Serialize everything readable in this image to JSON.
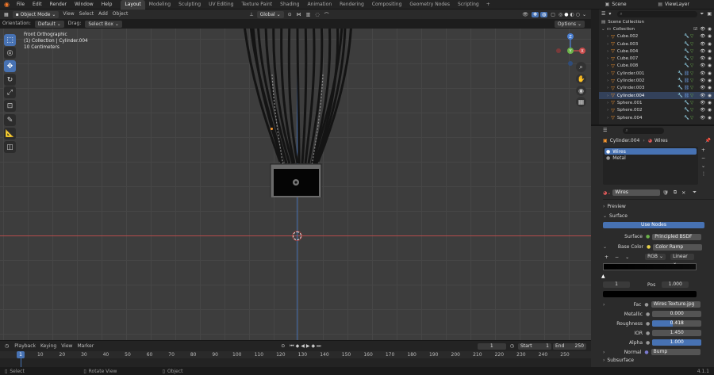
{
  "topbar": {
    "menus": [
      "File",
      "Edit",
      "Render",
      "Window",
      "Help"
    ],
    "workspaces": [
      "Layout",
      "Modeling",
      "Sculpting",
      "UV Editing",
      "Texture Paint",
      "Shading",
      "Animation",
      "Rendering",
      "Compositing",
      "Geometry Nodes",
      "Scripting"
    ],
    "active_workspace": "Layout",
    "scene": "Scene",
    "view_layer": "ViewLayer"
  },
  "viewport_header": {
    "mode": "Object Mode",
    "menus": [
      "View",
      "Select",
      "Add",
      "Object"
    ],
    "transform_orientation": "Global",
    "options_label": "Options"
  },
  "tool_header": {
    "orientation_label": "Orientation:",
    "orientation_value": "Default",
    "drag_label": "Drag:",
    "drag_value": "Select Box"
  },
  "overlay_info": {
    "view_name": "Front Orthographic",
    "context": "(1) Collection | Cylinder.004",
    "scale": "10 Centimeters"
  },
  "gizmo": {
    "z": "Z",
    "y": "Y",
    "x": "X"
  },
  "outliner": {
    "search_placeholder": "",
    "scene_collection": "Scene Collection",
    "collection": "Collection",
    "objects": [
      "Cube.002",
      "Cube.003",
      "Cube.004",
      "Cube.007",
      "Cube.008",
      "Cylinder.001",
      "Cylinder.002",
      "Cylinder.003",
      "Cylinder.004",
      "Sphere.001",
      "Sphere.002",
      "Sphere.004"
    ],
    "selected": "Cylinder.004"
  },
  "properties": {
    "object_name": "Cylinder.004",
    "material_name": "Wires",
    "material_slots": [
      "Wires",
      "Metal"
    ],
    "active_slot": "Wires",
    "material_field": "Wires",
    "preview_label": "Preview",
    "surface_panel": "Surface",
    "use_nodes": "Use Nodes",
    "surface_label": "Surface",
    "surface_value": "Principled BSDF",
    "base_color_label": "Base Color",
    "base_color_value": "Color Ramp",
    "color_mode": "RGB",
    "interpolation": "Linear",
    "stop_index": "1",
    "pos_label": "Pos",
    "pos_value": "1.000",
    "fac_label": "Fac",
    "fac_value": "Wires Texture.jpg",
    "metallic_label": "Metallic",
    "metallic_value": "0.000",
    "roughness_label": "Roughness",
    "roughness_value": "0.418",
    "roughness_fill": 0.418,
    "ior_label": "IOR",
    "ior_value": "1.450",
    "alpha_label": "Alpha",
    "alpha_value": "1.000",
    "alpha_fill": 1.0,
    "normal_label": "Normal",
    "normal_value": "Bump",
    "subsurface_label": "Subsurface"
  },
  "timeline": {
    "menus": [
      "Playback",
      "Keying",
      "View",
      "Marker"
    ],
    "current_frame": "1",
    "start_label": "Start",
    "start_value": "1",
    "end_label": "End",
    "end_value": "250",
    "ruler": [
      "1",
      "10",
      "20",
      "30",
      "40",
      "50",
      "60",
      "70",
      "80",
      "90",
      "100",
      "110",
      "120",
      "130",
      "140",
      "150",
      "160",
      "170",
      "180",
      "190",
      "200",
      "210",
      "220",
      "230",
      "240",
      "250"
    ]
  },
  "statusbar": {
    "items": [
      "Select",
      "Rotate View",
      "Object"
    ],
    "version": "4.1.1"
  },
  "colors": {
    "accent": "#4772b3",
    "axis_x": "#c94c4c",
    "axis_y": "#6cb34a",
    "axis_z": "#4b7fd1",
    "selection": "#ff9a2e",
    "bg": "#3d3d3d"
  }
}
